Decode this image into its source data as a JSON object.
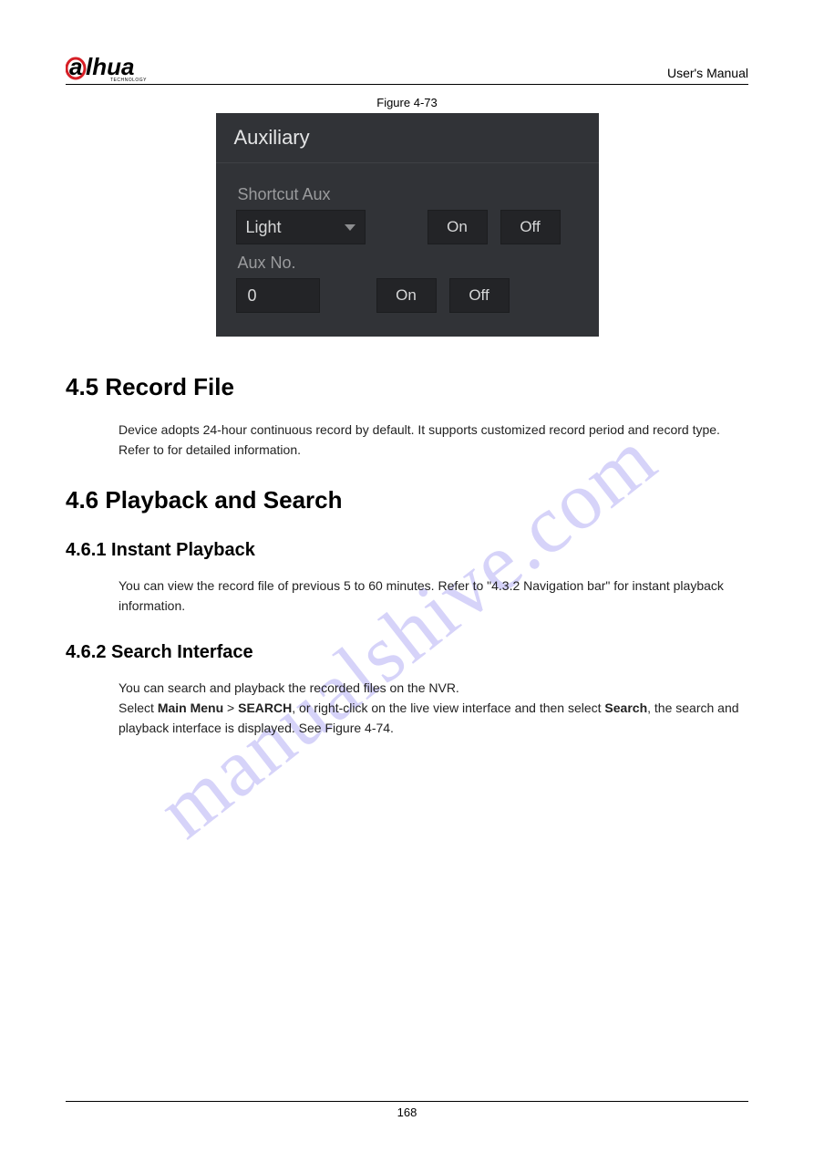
{
  "header": {
    "logo_text": "alhua",
    "logo_subtext": "TECHNOLOGY",
    "right_text": "User's Manual"
  },
  "figure": {
    "caption": "Figure 4-73",
    "panel_title": "Auxiliary",
    "label1": "Shortcut Aux",
    "select_value": "Light",
    "btn_on": "On",
    "btn_off": "Off",
    "label2": "Aux No.",
    "input_value": "0"
  },
  "section45": {
    "heading": "4.5 Record File",
    "para": "Device adopts 24-hour continuous record by default. It supports customized record period and record type. Refer to    for detailed information."
  },
  "section46": {
    "heading": "4.6 Playback and Search"
  },
  "section461": {
    "heading": "4.6.1 Instant Playback",
    "para": "You can view the record file of previous 5 to 60 minutes. Refer to \"4.3.2 Navigation bar\" for instant playback information."
  },
  "section462": {
    "heading": "4.6.2 Search Interface",
    "para_line1": "You can search and playback the recorded files on the NVR.",
    "para_select": "Select ",
    "para_mainmenu": "Main Menu",
    "para_gt": " > ",
    "para_search": "SEARCH",
    "para_mid": ", or right-click on the live view interface and then select ",
    "para_search2": "Search",
    "para_end": ", the search and playback interface is displayed. See Figure 4-74."
  },
  "watermark": "manualshive.com",
  "page_number": "168"
}
